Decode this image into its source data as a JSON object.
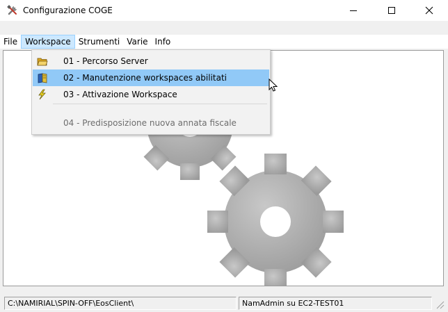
{
  "window": {
    "title": "Configurazione COGE",
    "app_icon": "tools-icon",
    "controls": [
      "minimize-icon",
      "maximize-icon",
      "close-icon"
    ]
  },
  "menubar": {
    "items": [
      {
        "label": "File"
      },
      {
        "label": "Workspace",
        "active": true
      },
      {
        "label": "Strumenti"
      },
      {
        "label": "Varie"
      },
      {
        "label": "Info"
      }
    ]
  },
  "workspace_menu": {
    "items": [
      {
        "label": "01 - Percorso Server",
        "icon": "open-folder-icon",
        "state": "normal"
      },
      {
        "label": "02 - Manutenzione workspaces abilitati",
        "icon": "book-icon",
        "state": "hover"
      },
      {
        "label": "03 - Attivazione Workspace",
        "icon": "lightning-icon",
        "state": "normal"
      },
      {
        "label": "04 - Predisposizione nuova annata fiscale",
        "icon": "",
        "state": "disabled"
      }
    ]
  },
  "main": {
    "background": "gears-icon"
  },
  "statusbar": {
    "path": "C:\\NAMIRIAL\\SPIN-OFF\\EosClient\\",
    "user": "NamAdmin su EC2-TEST01"
  },
  "colors": {
    "menu_hover": "#91c9f7",
    "menu_active": "#cce8ff",
    "gear": "#a6a6a6"
  }
}
